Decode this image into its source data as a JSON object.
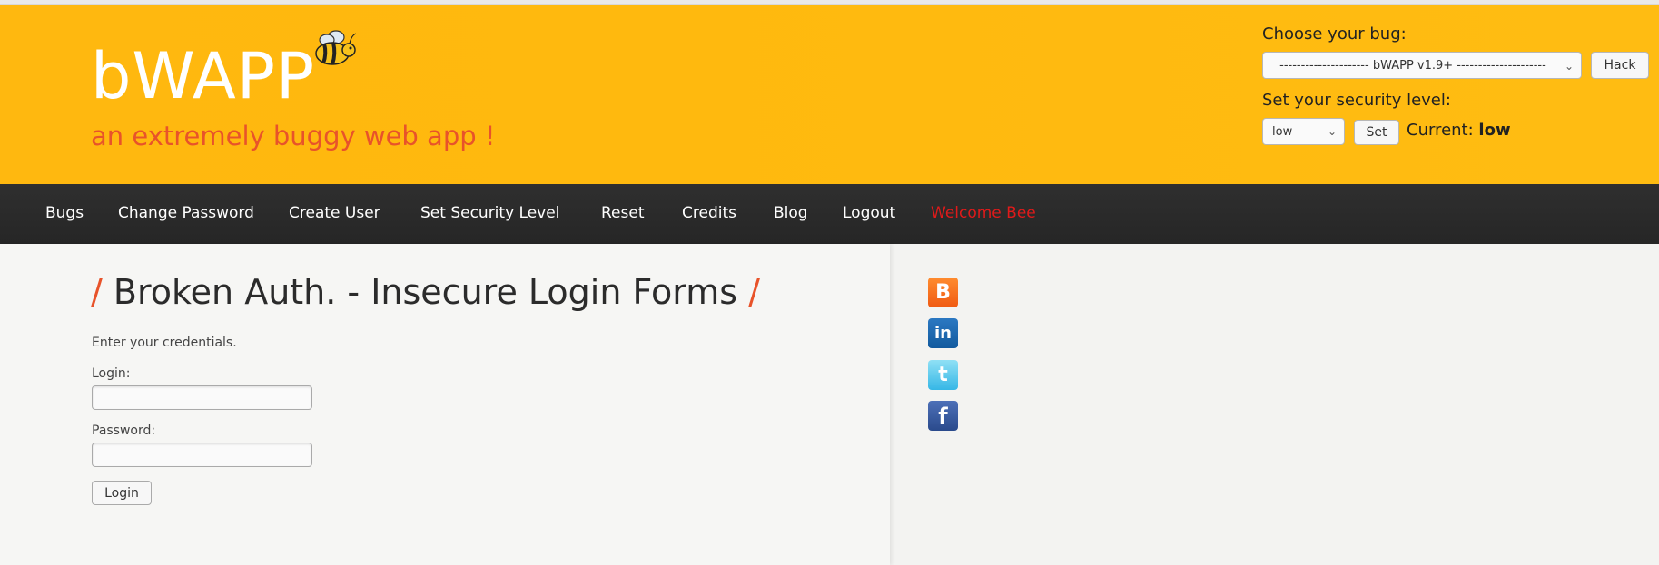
{
  "header": {
    "logo": "bWAPP",
    "tagline": "an extremely buggy web app !",
    "bug_label": "Choose your bug:",
    "bug_select_value": "--------------------- bWAPP v1.9+ ---------------------",
    "hack_label": "Hack",
    "security_label": "Set your security level:",
    "security_select_value": "low",
    "set_label": "Set",
    "current_prefix": "Current:",
    "current_value": "low"
  },
  "nav": {
    "items": [
      "Bugs",
      "Change Password",
      "Create User",
      "Set Security Level",
      "Reset",
      "Credits",
      "Blog",
      "Logout"
    ],
    "welcome": "Welcome Bee"
  },
  "main": {
    "slash_left": "/",
    "title": "Broken Auth. - Insecure Login Forms",
    "slash_right": "/",
    "intro": "Enter your credentials.",
    "login_label": "Login:",
    "login_value": "",
    "password_label": "Password:",
    "password_value": "",
    "login_button": "Login"
  },
  "social": {
    "icons": [
      "blogger-icon",
      "linkedin-icon",
      "twitter-icon",
      "facebook-icon"
    ],
    "glyphs": [
      "B",
      "in",
      "t",
      "f"
    ]
  },
  "colors": {
    "header_bg": "#ffb80f",
    "nav_bg": "#2b2b2b",
    "accent": "#e8532a",
    "welcome": "#e01a1a"
  }
}
